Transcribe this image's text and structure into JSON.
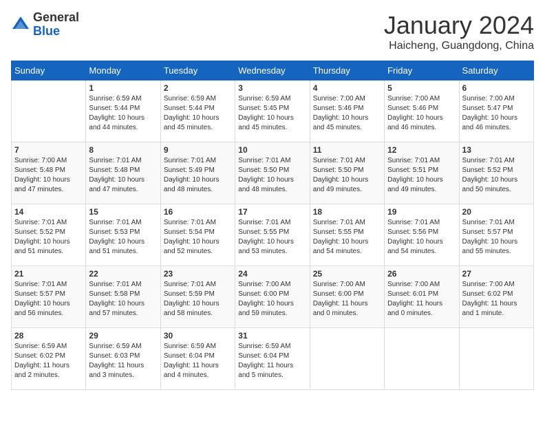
{
  "logo": {
    "general": "General",
    "blue": "Blue"
  },
  "title": "January 2024",
  "location": "Haicheng, Guangdong, China",
  "days_of_week": [
    "Sunday",
    "Monday",
    "Tuesday",
    "Wednesday",
    "Thursday",
    "Friday",
    "Saturday"
  ],
  "weeks": [
    [
      {
        "day": "",
        "info": ""
      },
      {
        "day": "1",
        "info": "Sunrise: 6:59 AM\nSunset: 5:44 PM\nDaylight: 10 hours\nand 44 minutes."
      },
      {
        "day": "2",
        "info": "Sunrise: 6:59 AM\nSunset: 5:44 PM\nDaylight: 10 hours\nand 45 minutes."
      },
      {
        "day": "3",
        "info": "Sunrise: 6:59 AM\nSunset: 5:45 PM\nDaylight: 10 hours\nand 45 minutes."
      },
      {
        "day": "4",
        "info": "Sunrise: 7:00 AM\nSunset: 5:46 PM\nDaylight: 10 hours\nand 45 minutes."
      },
      {
        "day": "5",
        "info": "Sunrise: 7:00 AM\nSunset: 5:46 PM\nDaylight: 10 hours\nand 46 minutes."
      },
      {
        "day": "6",
        "info": "Sunrise: 7:00 AM\nSunset: 5:47 PM\nDaylight: 10 hours\nand 46 minutes."
      }
    ],
    [
      {
        "day": "7",
        "info": "Sunrise: 7:00 AM\nSunset: 5:48 PM\nDaylight: 10 hours\nand 47 minutes."
      },
      {
        "day": "8",
        "info": "Sunrise: 7:01 AM\nSunset: 5:48 PM\nDaylight: 10 hours\nand 47 minutes."
      },
      {
        "day": "9",
        "info": "Sunrise: 7:01 AM\nSunset: 5:49 PM\nDaylight: 10 hours\nand 48 minutes."
      },
      {
        "day": "10",
        "info": "Sunrise: 7:01 AM\nSunset: 5:50 PM\nDaylight: 10 hours\nand 48 minutes."
      },
      {
        "day": "11",
        "info": "Sunrise: 7:01 AM\nSunset: 5:50 PM\nDaylight: 10 hours\nand 49 minutes."
      },
      {
        "day": "12",
        "info": "Sunrise: 7:01 AM\nSunset: 5:51 PM\nDaylight: 10 hours\nand 49 minutes."
      },
      {
        "day": "13",
        "info": "Sunrise: 7:01 AM\nSunset: 5:52 PM\nDaylight: 10 hours\nand 50 minutes."
      }
    ],
    [
      {
        "day": "14",
        "info": "Sunrise: 7:01 AM\nSunset: 5:52 PM\nDaylight: 10 hours\nand 51 minutes."
      },
      {
        "day": "15",
        "info": "Sunrise: 7:01 AM\nSunset: 5:53 PM\nDaylight: 10 hours\nand 51 minutes."
      },
      {
        "day": "16",
        "info": "Sunrise: 7:01 AM\nSunset: 5:54 PM\nDaylight: 10 hours\nand 52 minutes."
      },
      {
        "day": "17",
        "info": "Sunrise: 7:01 AM\nSunset: 5:55 PM\nDaylight: 10 hours\nand 53 minutes."
      },
      {
        "day": "18",
        "info": "Sunrise: 7:01 AM\nSunset: 5:55 PM\nDaylight: 10 hours\nand 54 minutes."
      },
      {
        "day": "19",
        "info": "Sunrise: 7:01 AM\nSunset: 5:56 PM\nDaylight: 10 hours\nand 54 minutes."
      },
      {
        "day": "20",
        "info": "Sunrise: 7:01 AM\nSunset: 5:57 PM\nDaylight: 10 hours\nand 55 minutes."
      }
    ],
    [
      {
        "day": "21",
        "info": "Sunrise: 7:01 AM\nSunset: 5:57 PM\nDaylight: 10 hours\nand 56 minutes."
      },
      {
        "day": "22",
        "info": "Sunrise: 7:01 AM\nSunset: 5:58 PM\nDaylight: 10 hours\nand 57 minutes."
      },
      {
        "day": "23",
        "info": "Sunrise: 7:01 AM\nSunset: 5:59 PM\nDaylight: 10 hours\nand 58 minutes."
      },
      {
        "day": "24",
        "info": "Sunrise: 7:00 AM\nSunset: 6:00 PM\nDaylight: 10 hours\nand 59 minutes."
      },
      {
        "day": "25",
        "info": "Sunrise: 7:00 AM\nSunset: 6:00 PM\nDaylight: 11 hours\nand 0 minutes."
      },
      {
        "day": "26",
        "info": "Sunrise: 7:00 AM\nSunset: 6:01 PM\nDaylight: 11 hours\nand 0 minutes."
      },
      {
        "day": "27",
        "info": "Sunrise: 7:00 AM\nSunset: 6:02 PM\nDaylight: 11 hours\nand 1 minute."
      }
    ],
    [
      {
        "day": "28",
        "info": "Sunrise: 6:59 AM\nSunset: 6:02 PM\nDaylight: 11 hours\nand 2 minutes."
      },
      {
        "day": "29",
        "info": "Sunrise: 6:59 AM\nSunset: 6:03 PM\nDaylight: 11 hours\nand 3 minutes."
      },
      {
        "day": "30",
        "info": "Sunrise: 6:59 AM\nSunset: 6:04 PM\nDaylight: 11 hours\nand 4 minutes."
      },
      {
        "day": "31",
        "info": "Sunrise: 6:59 AM\nSunset: 6:04 PM\nDaylight: 11 hours\nand 5 minutes."
      },
      {
        "day": "",
        "info": ""
      },
      {
        "day": "",
        "info": ""
      },
      {
        "day": "",
        "info": ""
      }
    ]
  ]
}
